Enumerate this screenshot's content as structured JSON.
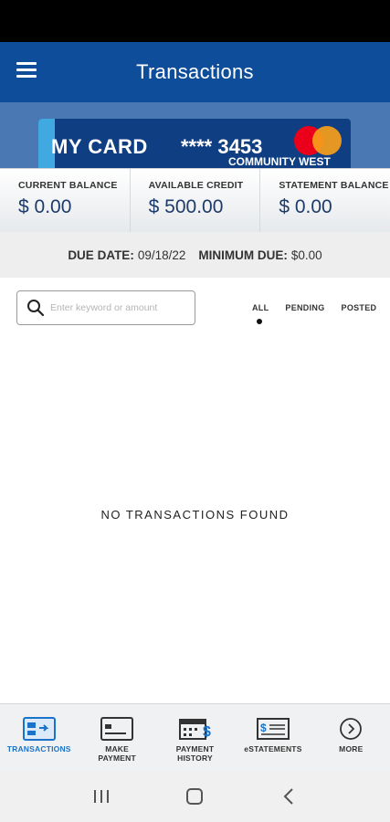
{
  "header": {
    "title": "Transactions"
  },
  "card": {
    "name": "MY CARD",
    "number": "**** 3453",
    "brand_text": "COMMUNITY WEST"
  },
  "balances": [
    {
      "label": "CURRENT BALANCE",
      "value": "$ 0.00"
    },
    {
      "label": "AVAILABLE CREDIT",
      "value": "$ 500.00"
    },
    {
      "label": "STATEMENT BALANCE",
      "value": "$ 0.00"
    }
  ],
  "due": {
    "due_date_label": "DUE DATE:",
    "due_date_value": "09/18/22",
    "min_due_label": "MINIMUM DUE:",
    "min_due_value": "$0.00"
  },
  "search": {
    "placeholder": "Enter keyword or amount",
    "value": ""
  },
  "filters": [
    {
      "label": "ALL",
      "selected": true
    },
    {
      "label": "PENDING",
      "selected": false
    },
    {
      "label": "POSTED",
      "selected": false
    }
  ],
  "empty_message": "NO TRANSACTIONS FOUND",
  "bottom_nav": [
    {
      "label": "TRANSACTIONS",
      "icon": "transactions-icon",
      "active": true
    },
    {
      "label": "MAKE\nPAYMENT",
      "icon": "card-payment-icon",
      "active": false
    },
    {
      "label": "PAYMENT\nHISTORY",
      "icon": "calendar-dollar-icon",
      "active": false
    },
    {
      "label": "eSTATEMENTS",
      "icon": "check-statement-icon",
      "active": false
    },
    {
      "label": "MORE",
      "icon": "chevron-right-circle-icon",
      "active": false
    }
  ],
  "colors": {
    "header_bg": "#0d4d9a",
    "accent": "#1a73c8",
    "balance_value": "#1d3b6a"
  }
}
